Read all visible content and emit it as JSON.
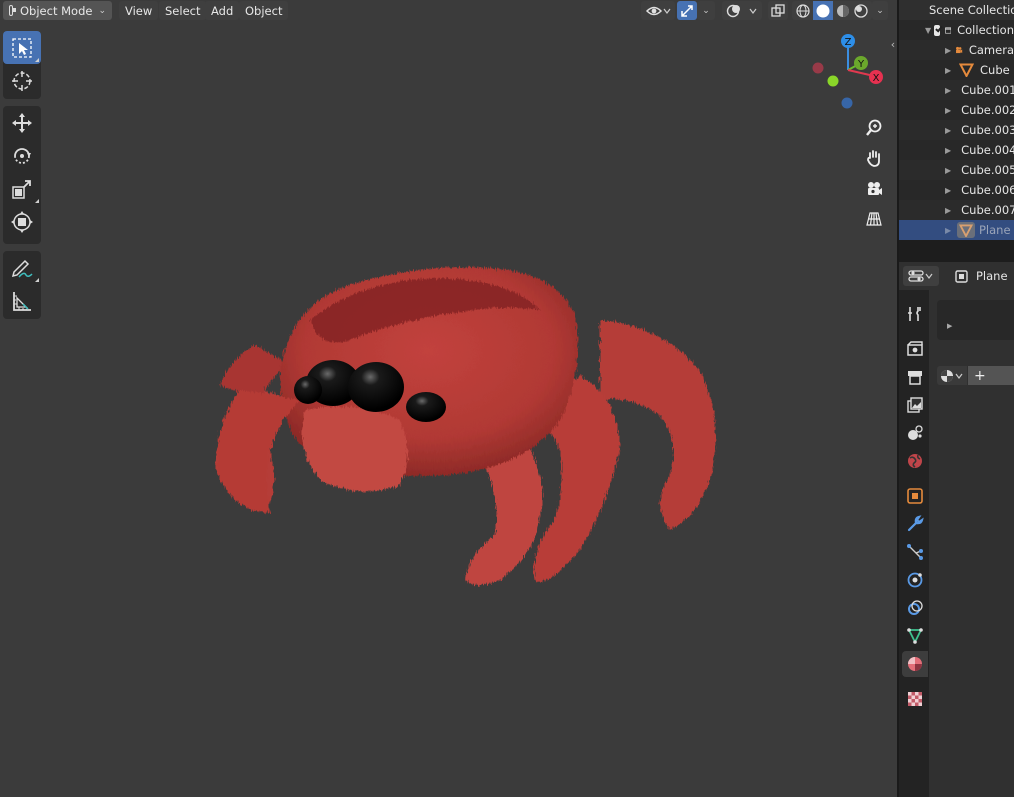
{
  "viewport_header": {
    "mode_label": "Object Mode",
    "menus": [
      "View",
      "Select",
      "Add",
      "Object"
    ]
  },
  "toolbar": {
    "tools": [
      {
        "icon": "select-box-icon",
        "active": true
      },
      {
        "icon": "cursor-icon"
      },
      {
        "icon": "move-icon"
      },
      {
        "icon": "rotate-icon"
      },
      {
        "icon": "scale-icon"
      },
      {
        "icon": "transform-icon"
      },
      {
        "icon": "annotate-icon"
      },
      {
        "icon": "measure-icon"
      }
    ]
  },
  "gizmo": {
    "z": "Z",
    "y": "Y",
    "x": "X"
  },
  "outliner": {
    "title": "Scene Collection",
    "collection": "Collection",
    "items": [
      {
        "label": "Camera",
        "icon": "camera-icon"
      },
      {
        "label": "Cube",
        "icon": "mesh-icon"
      },
      {
        "label": "Cube.001",
        "icon": "mesh-icon"
      },
      {
        "label": "Cube.002",
        "icon": "mesh-icon"
      },
      {
        "label": "Cube.003",
        "icon": "mesh-icon"
      },
      {
        "label": "Cube.004",
        "icon": "mesh-icon"
      },
      {
        "label": "Cube.005",
        "icon": "mesh-icon"
      },
      {
        "label": "Cube.006",
        "icon": "mesh-icon"
      },
      {
        "label": "Cube.007",
        "icon": "mesh-icon"
      },
      {
        "label": "Plane",
        "icon": "mesh-icon",
        "selected": true
      }
    ]
  },
  "properties": {
    "object_name": "Plane",
    "add_label": "+"
  },
  "colors": {
    "accent": "#4772b3",
    "mesh_orange": "#e58a3c",
    "crab_red": "#b63a36"
  }
}
